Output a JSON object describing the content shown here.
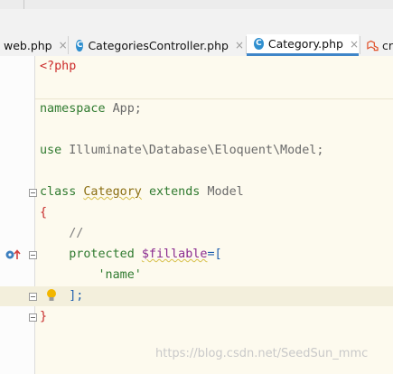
{
  "tabs": [
    {
      "label": "web.php",
      "active": false,
      "icon": "none",
      "close": "×"
    },
    {
      "label": "CategoriesController.php",
      "active": false,
      "icon": "class-c-icon",
      "close": "×"
    },
    {
      "label": "Category.php",
      "active": true,
      "icon": "class-c-icon",
      "close": "×"
    },
    {
      "label": "cr",
      "active": false,
      "icon": "laravel-icon",
      "close": ""
    }
  ],
  "tab_icon_letter": "C",
  "code": {
    "php_open": "<?php",
    "namespace_kw": "namespace",
    "namespace_name": "App;",
    "use_kw": "use",
    "use_path": "Illuminate\\Database\\Eloquent\\Model;",
    "class_kw": "class",
    "class_name": "Category",
    "extends_kw": "extends",
    "parent_class": "Model",
    "brace_open": "{",
    "comment": "//",
    "protected_kw": "protected",
    "fillable_var": "$fillable",
    "assign_bracket": "=[",
    "string_value": "'name'",
    "array_close": "];",
    "brace_close": "}"
  },
  "watermark": "https://blog.csdn.net/SeedSun_mmc",
  "colors": {
    "editor_bg": "#fdfaee",
    "active_tab_underline": "#3f85c8",
    "keyword": "#2f7a2f",
    "php_tag": "#cc2b2b"
  }
}
